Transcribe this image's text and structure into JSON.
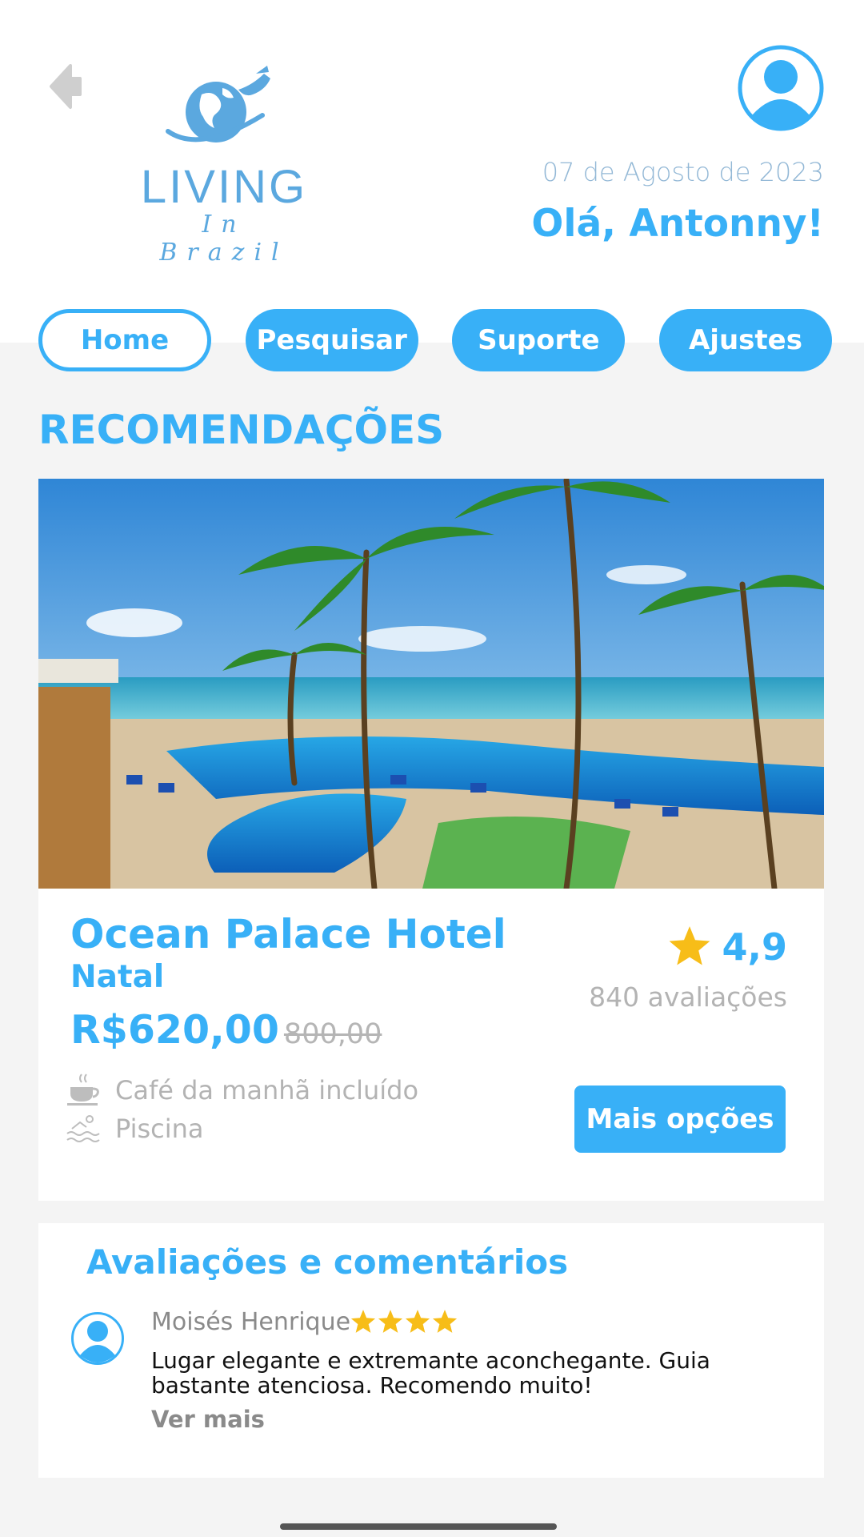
{
  "header": {
    "logo_word": "LIVING",
    "logo_sub": "In Brazil",
    "date": "07 de Agosto de 2023",
    "greeting": "Olá, Antonny!"
  },
  "nav": {
    "tabs": [
      {
        "label": "Home",
        "active": true
      },
      {
        "label": "Pesquisar",
        "active": false
      },
      {
        "label": "Suporte",
        "active": false
      },
      {
        "label": "Ajustes",
        "active": false
      }
    ]
  },
  "recommendations": {
    "title": "RECOMENDAÇÕES",
    "hotel": {
      "name": "Ocean Palace Hotel",
      "city": "Natal",
      "price": "R$620,00",
      "old_price": "800,00",
      "rating": "4,9",
      "reviews_count": "840 avaliações",
      "amenities": [
        {
          "icon": "coffee-cup-icon",
          "label": "Café da manhã incluído"
        },
        {
          "icon": "pool-icon",
          "label": "Piscina"
        }
      ],
      "more_button": "Mais opções"
    }
  },
  "reviews": {
    "title": "Avaliações e comentários",
    "items": [
      {
        "author": "Moisés Henrique",
        "stars": 4,
        "text": "Lugar elegante e extremante aconchegante. Guia bastante atenciosa. Recomendo muito!",
        "see_more": "Ver mais"
      }
    ]
  },
  "colors": {
    "primary": "#38b0f7",
    "logo": "#5ba8df",
    "star": "#f7bd18",
    "muted": "#b3b3b3"
  }
}
